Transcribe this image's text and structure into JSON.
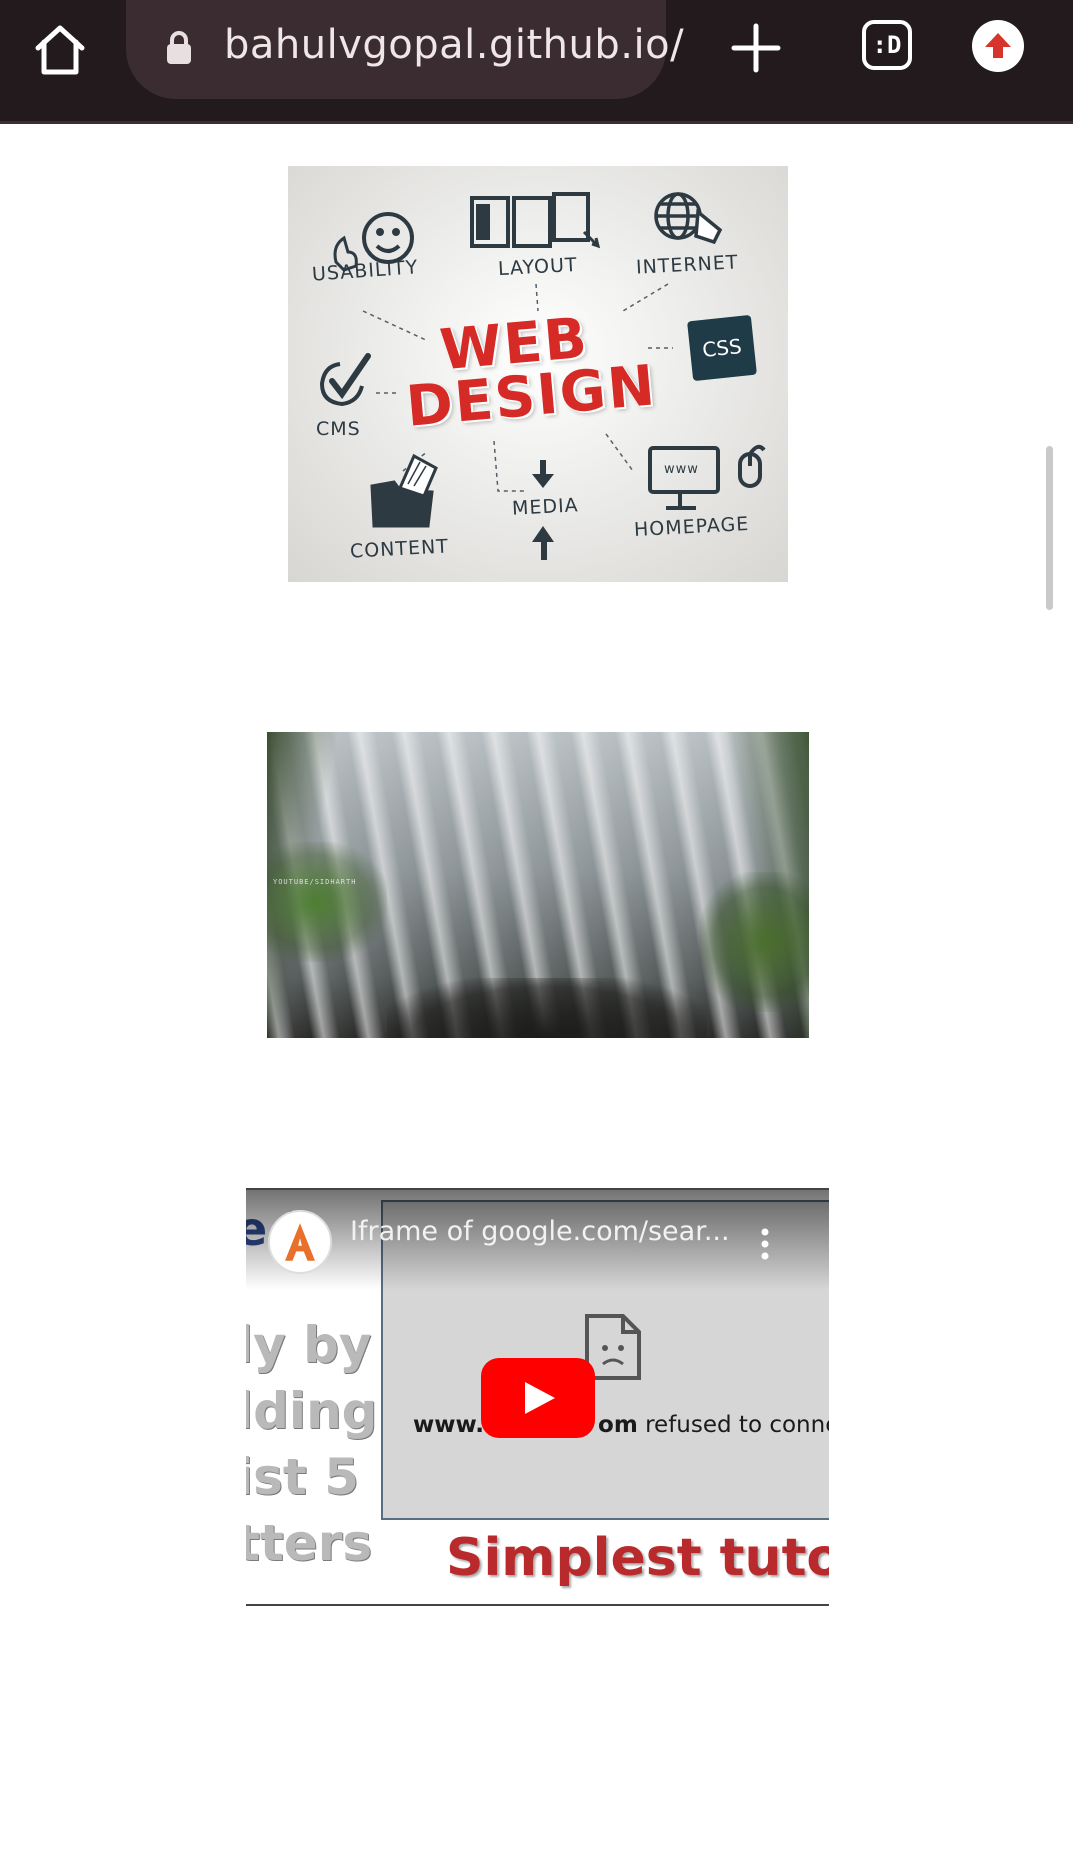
{
  "browser": {
    "url": "bahulvgopal.github.io/",
    "tabs_label": ":D"
  },
  "webdesign_image": {
    "title_line1": "WEB",
    "title_line2": "DESIGN",
    "labels": {
      "usability": "USABILITY",
      "layout": "LAYOUT",
      "internet": "INTERNET",
      "css": "CSS",
      "cms": "CMS",
      "content": "CONTENT",
      "media": "MEDIA",
      "homepage": "HOMEPAGE",
      "www": "www"
    }
  },
  "waterfall_video": {
    "watermark": "YOUTUBE/SIDHARTH"
  },
  "youtube_embed": {
    "title": "Iframe of google.com/sear...",
    "left_lines": [
      "ly by",
      "lding",
      "ist 5",
      "tters"
    ],
    "exclaim": "e !",
    "refused_domain_start": "www.",
    "refused_domain_end": "om",
    "refused_text": " refused to connect",
    "bottom_text": "Simplest tutori"
  },
  "colors": {
    "toolbar": "#221a1c",
    "urlbar": "#3a2c30",
    "accent_red": "#d62a26",
    "youtube_red": "#ff0000"
  }
}
